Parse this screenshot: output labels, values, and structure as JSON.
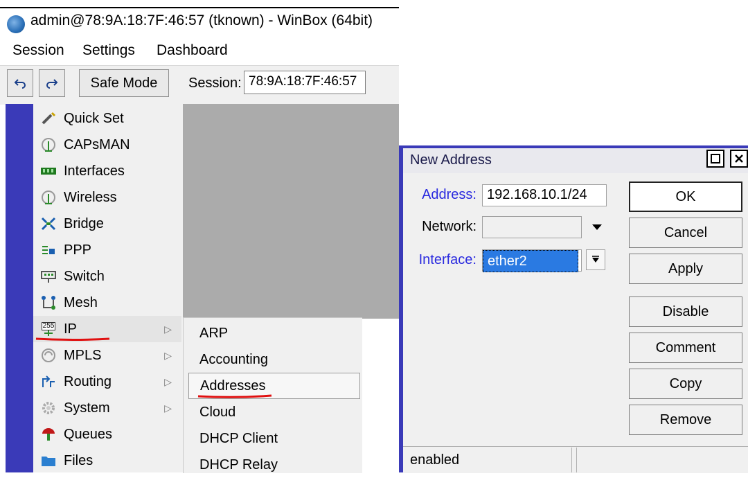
{
  "window": {
    "title": "admin@78:9A:18:7F:46:57 (tknown) - WinBox (64bit)"
  },
  "menubar": [
    "Session",
    "Settings",
    "Dashboard"
  ],
  "toolbar": {
    "undo_icon": "undo-icon",
    "redo_icon": "redo-icon",
    "safe_mode": "Safe Mode",
    "session_label": "Session:",
    "session_value": "78:9A:18:7F:46:57"
  },
  "sidebar": {
    "items": [
      {
        "label": "Quick Set",
        "icon": "wand-icon",
        "submenu": false
      },
      {
        "label": "CAPsMAN",
        "icon": "antenna-icon",
        "submenu": false
      },
      {
        "label": "Interfaces",
        "icon": "interfaces-icon",
        "submenu": false
      },
      {
        "label": "Wireless",
        "icon": "wireless-icon",
        "submenu": false
      },
      {
        "label": "Bridge",
        "icon": "bridge-icon",
        "submenu": false
      },
      {
        "label": "PPP",
        "icon": "ppp-icon",
        "submenu": false
      },
      {
        "label": "Switch",
        "icon": "switch-icon",
        "submenu": false
      },
      {
        "label": "Mesh",
        "icon": "mesh-icon",
        "submenu": false
      },
      {
        "label": "IP",
        "icon": "ip-icon",
        "icon_text": "255",
        "submenu": true
      },
      {
        "label": "MPLS",
        "icon": "mpls-icon",
        "submenu": true
      },
      {
        "label": "Routing",
        "icon": "routing-icon",
        "submenu": true
      },
      {
        "label": "System",
        "icon": "gear-icon",
        "submenu": true
      },
      {
        "label": "Queues",
        "icon": "queues-icon",
        "submenu": false
      },
      {
        "label": "Files",
        "icon": "folder-icon",
        "submenu": false
      }
    ]
  },
  "ip_submenu": {
    "items": [
      "ARP",
      "Accounting",
      "Addresses",
      "Cloud",
      "DHCP Client",
      "DHCP Relay"
    ],
    "selected": "Addresses"
  },
  "dialog": {
    "title": "New Address",
    "fields": {
      "address": {
        "label": "Address:",
        "value": "192.168.10.1/24"
      },
      "network": {
        "label": "Network:",
        "value": ""
      },
      "interface": {
        "label": "Interface:",
        "value": "ether2"
      }
    },
    "buttons": [
      "OK",
      "Cancel",
      "Apply",
      "Disable",
      "Comment",
      "Copy",
      "Remove"
    ],
    "status": "enabled"
  },
  "colors": {
    "accent": "#3a3ab8",
    "highlight_red": "#e01010",
    "selection": "#2a7ae2"
  }
}
